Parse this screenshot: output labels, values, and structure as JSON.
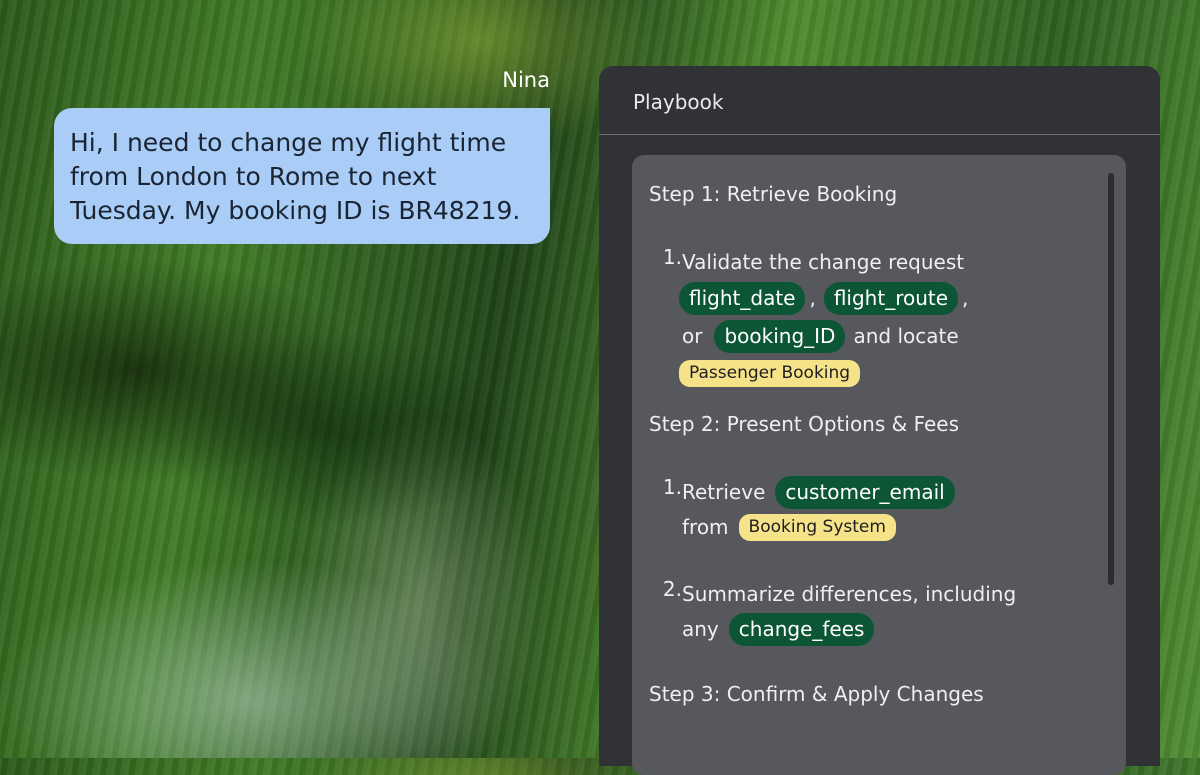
{
  "chat": {
    "sender": "Nina",
    "message_lines": [
      "Hi, I need to change my flight time",
      "from London to Rome to next",
      "Tuesday. My booking ID is BR48219."
    ]
  },
  "playbook": {
    "title": "Playbook",
    "steps": [
      {
        "title": "Step 1: Retrieve Booking",
        "items": [
          {
            "number": "1.",
            "text_1": "Validate the change request",
            "token_1": "flight_date",
            "sep_1": ",",
            "token_2": "flight_route",
            "sep_2": ",",
            "text_2": "or",
            "token_3": "booking_ID",
            "text_3": "and locate",
            "source_1": "Passenger Booking"
          }
        ]
      },
      {
        "title": "Step 2: Present Options & Fees",
        "items": [
          {
            "number": "1.",
            "text_1": "Retrieve",
            "token_1": "customer_email",
            "text_2": "from",
            "source_1": "Booking System"
          },
          {
            "number": "2.",
            "text_1": "Summarize differences, including",
            "text_2": "any",
            "token_1": "change_fees"
          }
        ]
      },
      {
        "title": "Step 3: Confirm & Apply Changes",
        "items": []
      }
    ]
  },
  "colors": {
    "bubble": "#a9cdf7",
    "panel": "#303236",
    "card": "#56585d",
    "token": "#0c5636",
    "source_tag": "#f6e288"
  }
}
